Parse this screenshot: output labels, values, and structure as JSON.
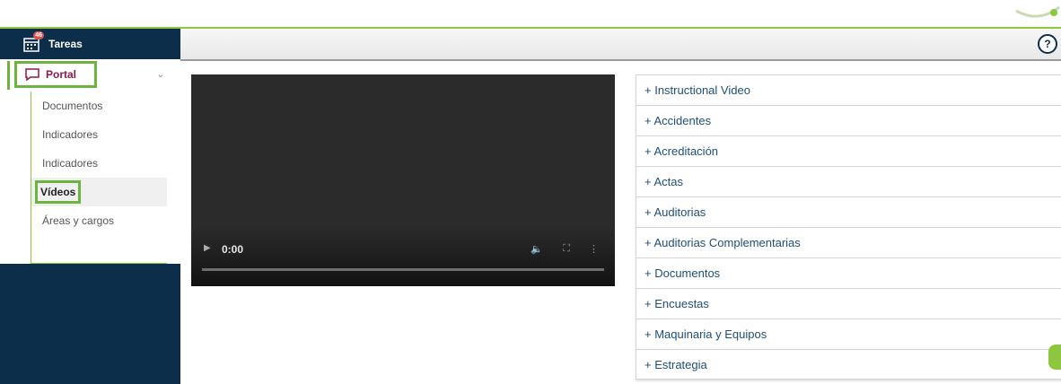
{
  "topbar": {
    "accent": "#8dc63f"
  },
  "sidebar": {
    "tareas_label": "Tareas",
    "tareas_badge": "46",
    "portal_label": "Portal",
    "items": [
      {
        "label": "Documentos"
      },
      {
        "label": "Indicadores"
      },
      {
        "label": "Indicadores"
      },
      {
        "label": "Vídeos"
      },
      {
        "label": "Áreas y cargos"
      }
    ]
  },
  "header": {
    "help_label": "?"
  },
  "video": {
    "time": "0:00"
  },
  "accordion": {
    "items": [
      {
        "label": "+ Instructional Video"
      },
      {
        "label": "+ Accidentes"
      },
      {
        "label": "+ Acreditación"
      },
      {
        "label": "+ Actas"
      },
      {
        "label": "+ Auditorias"
      },
      {
        "label": "+ Auditorias Complementarias"
      },
      {
        "label": "+ Documentos"
      },
      {
        "label": "+ Encuestas"
      },
      {
        "label": "+ Maquinaria y Equipos"
      },
      {
        "label": "+ Estrategia"
      }
    ]
  },
  "colors": {
    "sidebar_bg": "#0d2e4a",
    "highlight": "#6db33f",
    "link": "#1f4e79"
  }
}
